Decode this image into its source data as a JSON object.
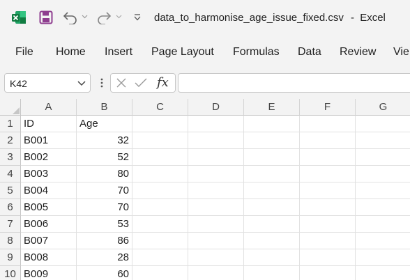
{
  "window": {
    "filename": "data_to_harmonise_age_issue_fixed.csv",
    "separator": "-",
    "app_name": "Excel"
  },
  "ribbon": {
    "tabs": [
      "File",
      "Home",
      "Insert",
      "Page Layout",
      "Formulas",
      "Data",
      "Review",
      "Vie"
    ]
  },
  "formula_bar": {
    "name_box": "K42",
    "fx_label": "fx",
    "formula": ""
  },
  "icons": [
    "excel-logo-icon",
    "save-icon",
    "undo-icon",
    "redo-icon",
    "customize-qat-icon",
    "cancel-icon",
    "enter-icon",
    "insert-function-icon"
  ],
  "colors": {
    "excel_green": "#107c41",
    "save_purple": "#8e3d8f"
  },
  "sheet": {
    "columns": [
      "A",
      "B",
      "C",
      "D",
      "E",
      "F",
      "G"
    ],
    "rows": [
      {
        "num": "1",
        "id": "ID",
        "age": "Age"
      },
      {
        "num": "2",
        "id": "B001",
        "age": "32"
      },
      {
        "num": "3",
        "id": "B002",
        "age": "52"
      },
      {
        "num": "4",
        "id": "B003",
        "age": "80"
      },
      {
        "num": "5",
        "id": "B004",
        "age": "70"
      },
      {
        "num": "6",
        "id": "B005",
        "age": "70"
      },
      {
        "num": "7",
        "id": "B006",
        "age": "53"
      },
      {
        "num": "8",
        "id": "B007",
        "age": "86"
      },
      {
        "num": "9",
        "id": "B008",
        "age": "28"
      },
      {
        "num": "10",
        "id": "B009",
        "age": "60"
      }
    ]
  }
}
